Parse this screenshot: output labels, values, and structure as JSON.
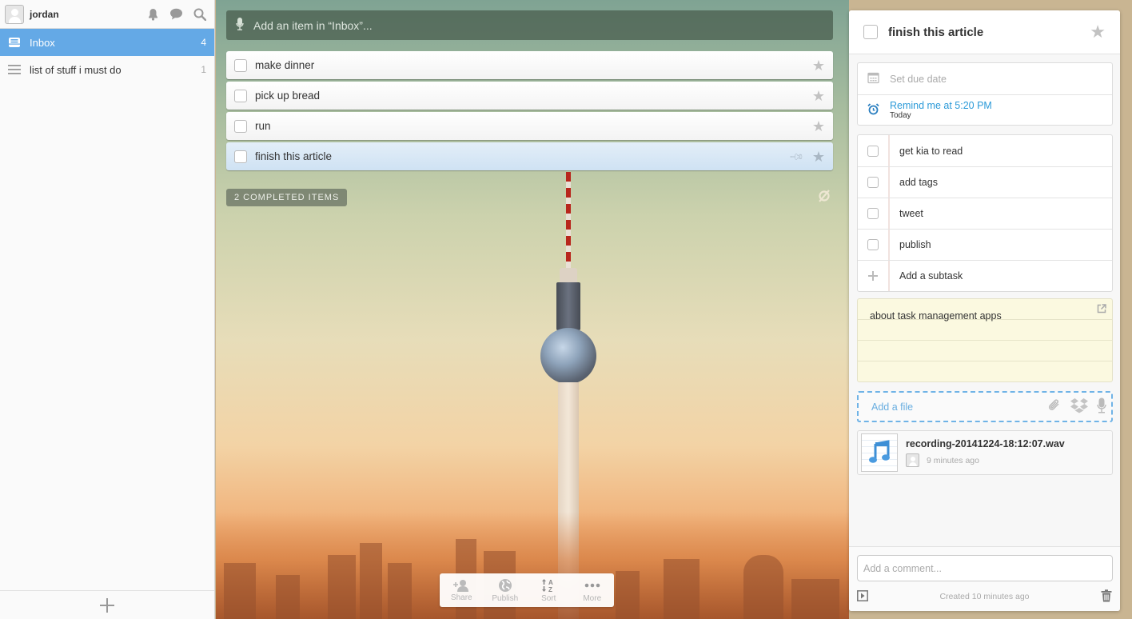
{
  "sidebar": {
    "user_name": "jordan",
    "lists": [
      {
        "label": "Inbox",
        "count": "4",
        "icon": "inbox-icon",
        "active": true
      },
      {
        "label": "list of stuff i must do",
        "count": "1",
        "icon": "list-icon",
        "active": false
      }
    ]
  },
  "main": {
    "add_placeholder": "Add an item in “Inbox”...",
    "tasks": [
      {
        "title": "make dinner",
        "starred": false
      },
      {
        "title": "pick up bread",
        "starred": false
      },
      {
        "title": "run",
        "starred": false
      },
      {
        "title": "finish this article",
        "starred": false,
        "selected": true
      }
    ],
    "completed_label": "2 COMPLETED ITEMS",
    "toolbar": [
      {
        "label": "Share",
        "icon": "add-person-icon"
      },
      {
        "label": "Publish",
        "icon": "globe-icon"
      },
      {
        "label": "Sort",
        "icon": "sort-az-icon"
      },
      {
        "label": "More",
        "icon": "more-dots-icon"
      }
    ]
  },
  "detail": {
    "title": "finish this article",
    "due_date_label": "Set due date",
    "reminder_label": "Remind me at 5:20 PM",
    "reminder_day": "Today",
    "subtasks": [
      "get kia to read",
      "add tags",
      "tweet",
      "publish"
    ],
    "add_subtask_placeholder": "Add a subtask",
    "note": "about task management apps",
    "add_file_label": "Add a file",
    "file": {
      "name": "recording-20141224-18:12:07.wav",
      "time": "9 minutes ago"
    },
    "comment_placeholder": "Add a comment...",
    "created": "Created 10 minutes ago"
  },
  "colors": {
    "accent_blue": "#64a9e6",
    "reminder_blue": "#2b9ad8",
    "note_yellow": "#fbf9e0"
  }
}
